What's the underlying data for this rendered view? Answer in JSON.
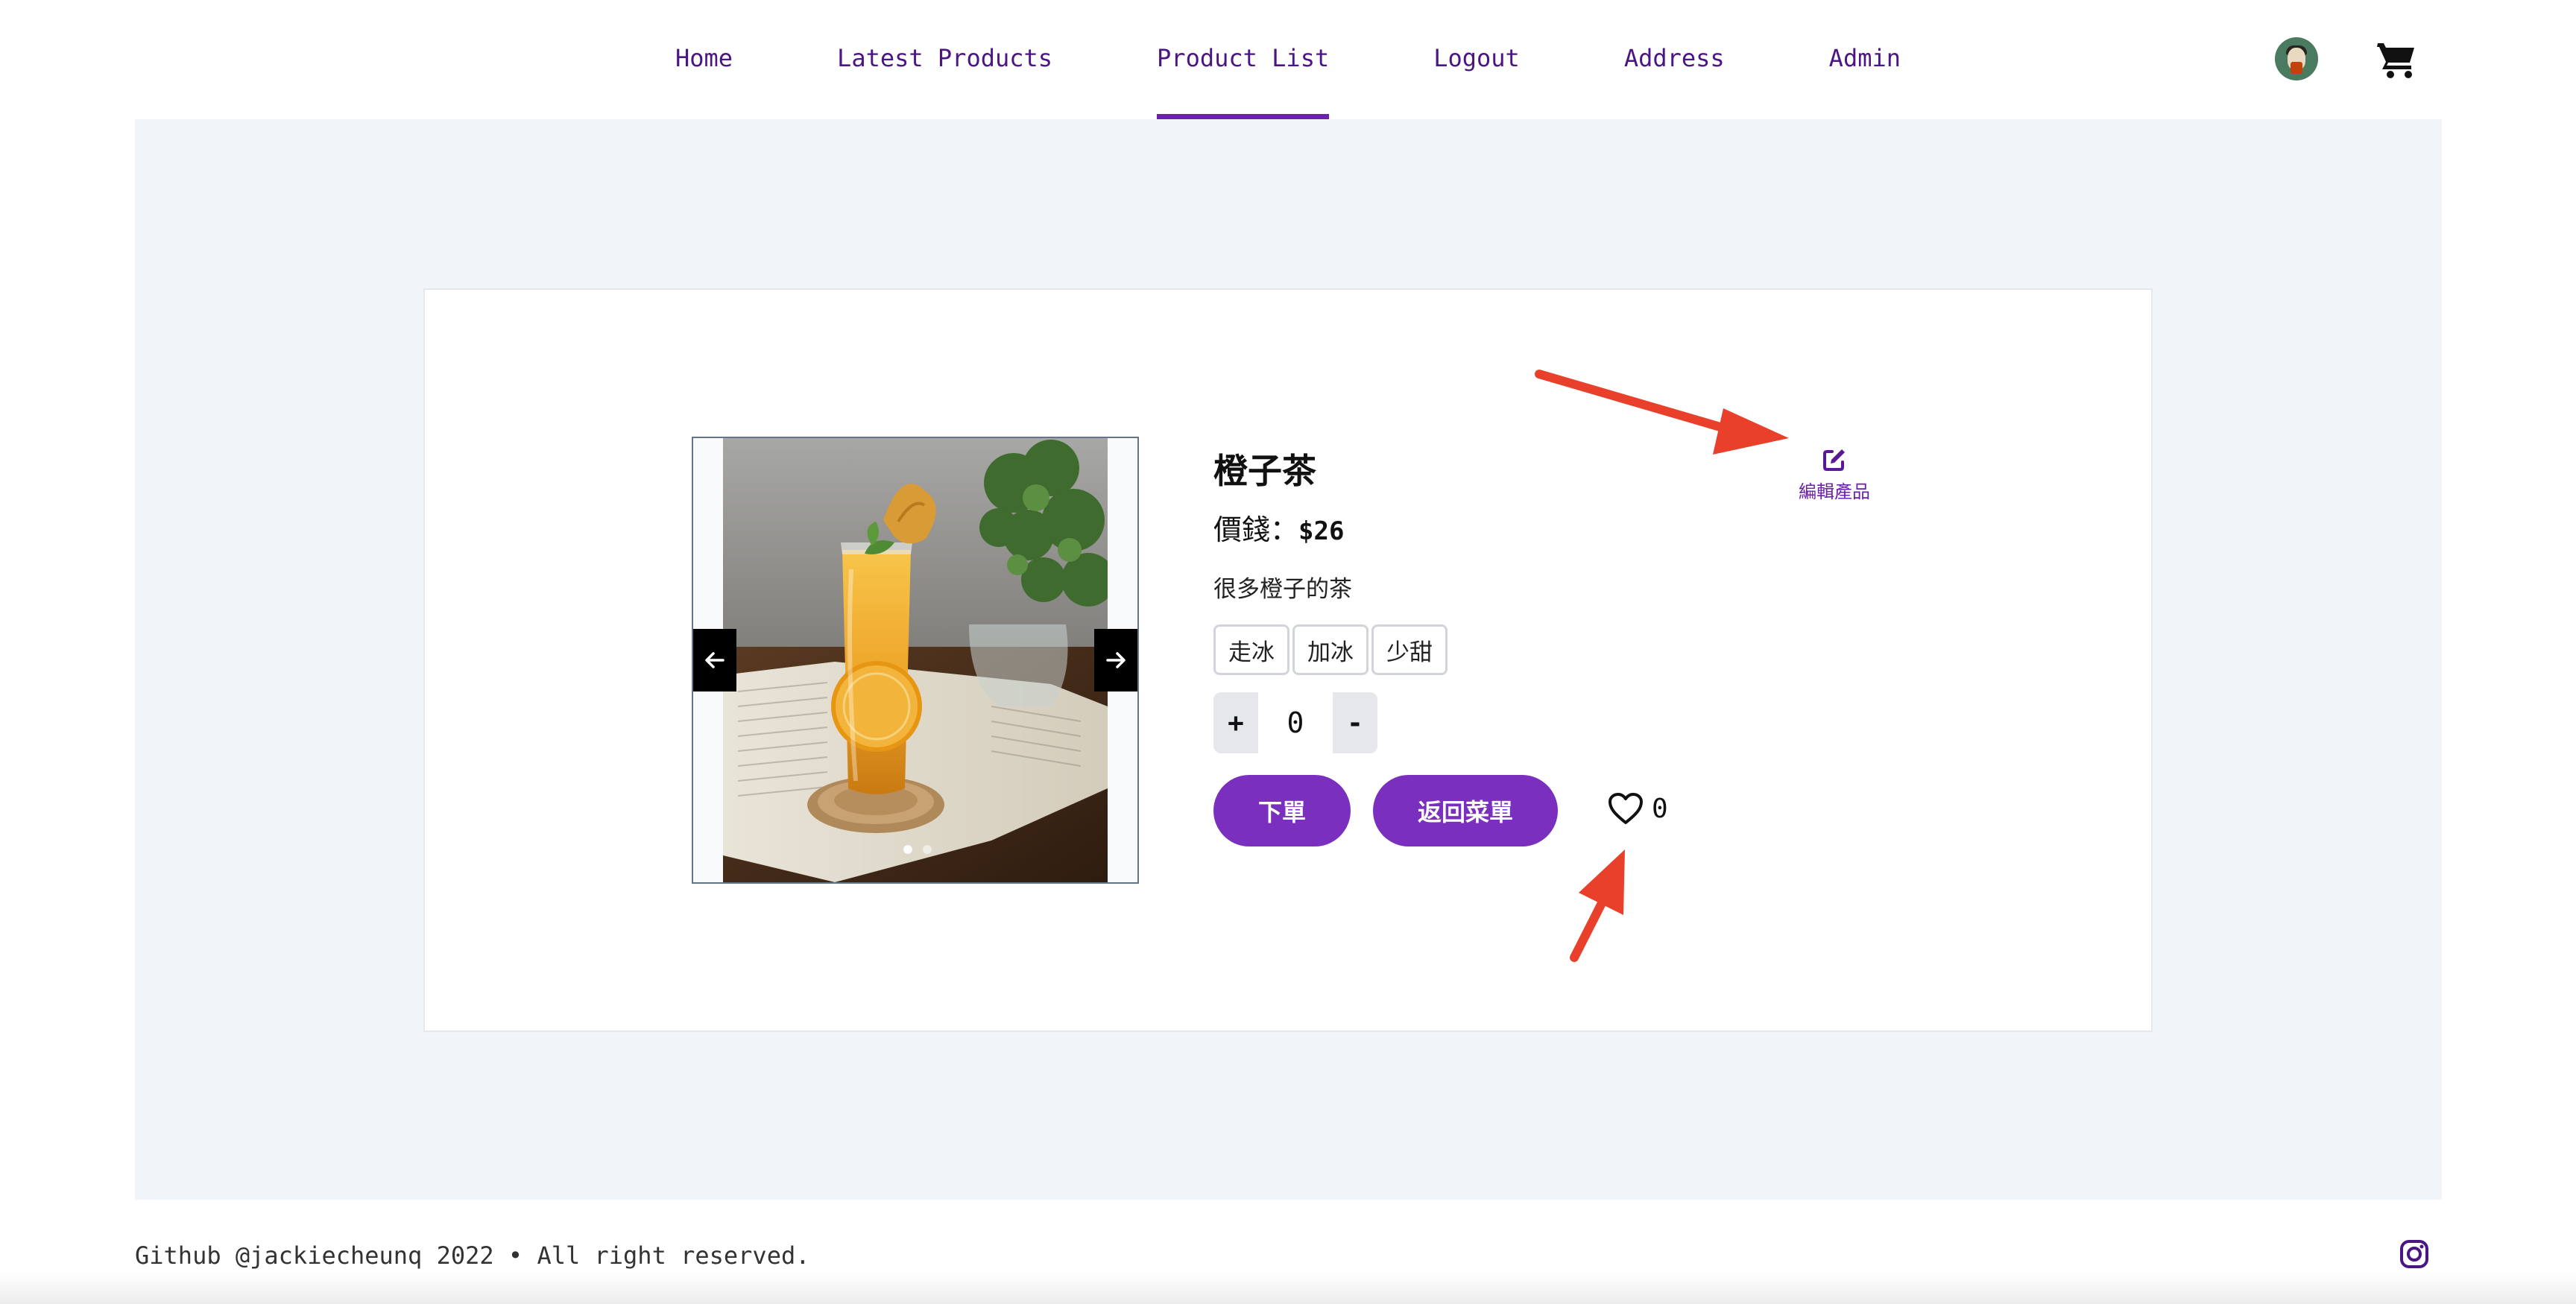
{
  "nav": {
    "links": [
      {
        "label": "Home",
        "active": false
      },
      {
        "label": "Latest Products",
        "active": false
      },
      {
        "label": "Product List",
        "active": true
      },
      {
        "label": "Logout",
        "active": false
      },
      {
        "label": "Address",
        "active": false
      },
      {
        "label": "Admin",
        "active": false
      }
    ],
    "avatar_icon": "avatar",
    "cart_icon": "shopping-cart-icon",
    "accent_color": "#4b1583"
  },
  "product": {
    "title": "橙子茶",
    "price_label": "價錢：",
    "price_value": "$26",
    "description": "很多橙子的茶",
    "options": [
      "走冰",
      "加冰",
      "少甜"
    ],
    "quantity": {
      "plus": "+",
      "value": "0",
      "minus": "-"
    },
    "order_button": "下單",
    "back_button": "返回菜單",
    "likes": "0",
    "edit_label": "編輯產品",
    "carousel": {
      "prev_icon": "arrow-left-icon",
      "next_icon": "arrow-right-icon",
      "slide_count": 2,
      "active_slide": 1
    }
  },
  "colors": {
    "button_purple": "#7b2fbe",
    "page_background": "#f1f4f9",
    "annotation_red": "#e8402a"
  },
  "footer": {
    "text": "Github @jackiecheunq 2022 • All right reserved.",
    "social_icon": "instagram-icon"
  }
}
